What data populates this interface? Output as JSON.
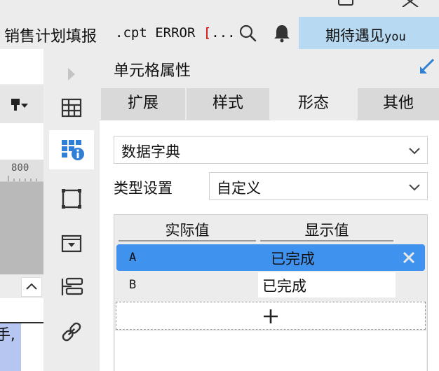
{
  "app": {
    "title_cn": "销售计划填报",
    "title_ascii": ".cpt ERROR ",
    "title_bracket": "[",
    "title_ellipsis": "...",
    "user_name_cn": "期待遇见",
    "user_name_en": "you"
  },
  "left": {
    "ruler_label": "800",
    "cell_text": "手,"
  },
  "panel": {
    "title": "单元格属性",
    "tabs": [
      "扩展",
      "样式",
      "形态",
      "其他"
    ],
    "active_tab": "形态",
    "form_type_value": "数据字典",
    "type_setting_label": "类型设置",
    "type_setting_value": "自定义",
    "dict": {
      "headers": [
        "实际值",
        "显示值"
      ],
      "rows": [
        {
          "actual": "A",
          "display": "已完成",
          "selected": true
        },
        {
          "actual": "B",
          "display": "已完成",
          "selected": false
        }
      ],
      "add_icon": "plus-icon"
    }
  },
  "colors": {
    "accent": "#3f92ee",
    "user_box": "#b8d9f2",
    "pin": "#2f7fd6",
    "error_bracket": "#cc0000"
  },
  "icons": [
    "window-restore-icon",
    "window-close-icon",
    "search-icon",
    "bell-icon",
    "format-painter-icon",
    "expand-arrow-icon",
    "cell-element-icon",
    "cell-attr-icon",
    "float-element-icon",
    "widget-icon",
    "condition-icon",
    "hyperlink-icon",
    "pin-icon",
    "chevron-down-icon",
    "delete-row-icon",
    "plus-icon",
    "scroll-up-icon"
  ]
}
